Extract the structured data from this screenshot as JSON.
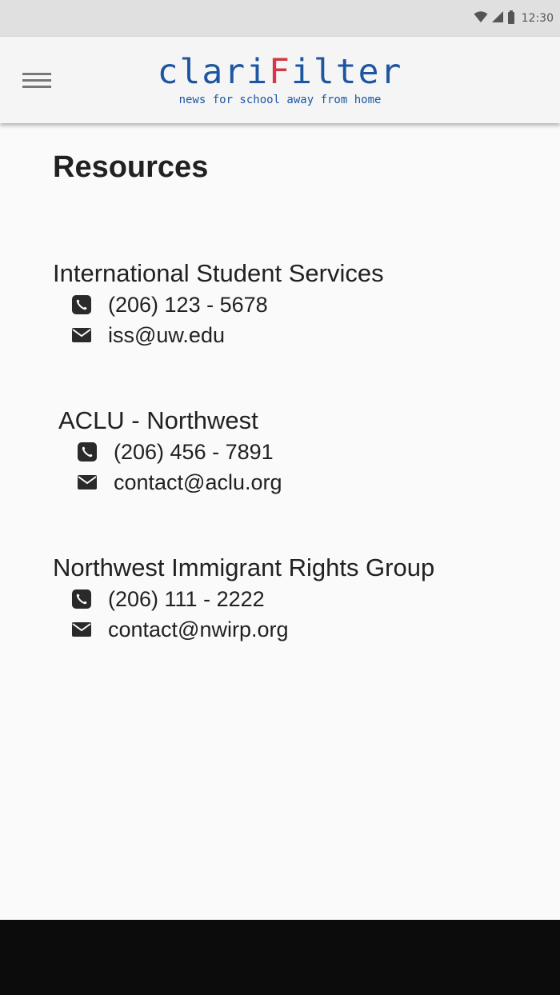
{
  "status_bar": {
    "time": "12:30",
    "icons": [
      "wifi-icon",
      "cell-signal-icon",
      "battery-icon"
    ]
  },
  "app_bar": {
    "logo_prefix": "clari",
    "logo_accent": "F",
    "logo_suffix": "ilter",
    "tagline": "news for school away from home",
    "brand_color": "#1d56a3",
    "accent_color": "#d63647",
    "menu_icon": "hamburger-menu-icon"
  },
  "page": {
    "title": "Resources"
  },
  "resources": [
    {
      "name": "International Student Services",
      "phone": "(206) 123 - 5678",
      "email": "iss@uw.edu"
    },
    {
      "name": "ACLU - Northwest",
      "phone": "(206) 456 - 7891",
      "email": "contact@aclu.org"
    },
    {
      "name": "Northwest Immigrant Rights Group",
      "phone": "(206) 111 - 2222",
      "email": "contact@nwirp.org"
    }
  ]
}
